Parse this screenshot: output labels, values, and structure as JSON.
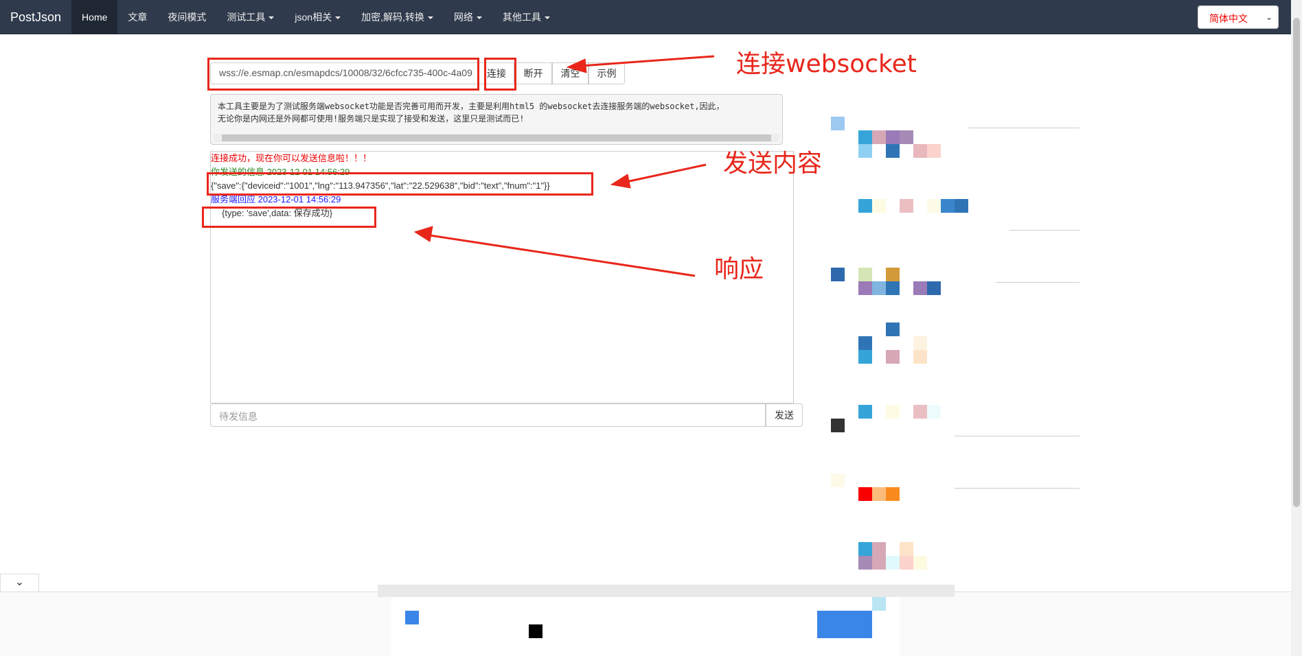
{
  "navbar": {
    "brand": "PostJson",
    "items": [
      {
        "label": "Home"
      },
      {
        "label": "文章"
      },
      {
        "label": "夜间模式"
      },
      {
        "label": "测试工具"
      },
      {
        "label": "json相关"
      },
      {
        "label": "加密,解码,转换"
      },
      {
        "label": "网络"
      },
      {
        "label": "其他工具"
      }
    ],
    "language": "简体中文"
  },
  "tool": {
    "url_value": "wss://e.esmap.cn/esmapdcs/10008/32/6cfcc735-400c-4a09",
    "buttons": {
      "connect": "连接",
      "disconnect": "断开",
      "clear": "清空",
      "example": "示例"
    },
    "description_line1": "本工具主要是为了测试服务端websocket功能是否完善可用而开发，主要是利用html5 的websocket去连接服务端的websocket,因此，",
    "description_line2": "无论你是内网还是外网都可使用!服务端只是实现了接受和发送，这里只是测试而已!",
    "log": {
      "connected": "连接成功，现在你可以发送信息啦！！！",
      "sent_header": "你发送的信息 2023-12-01 14:56:29",
      "sent_body": "{\"save\":{\"deviceid\":\"1001\",\"lng\":\"113.947356\",\"lat\":\"22.529638\",\"bid\":\"text\",\"fnum\":\"1\"}}",
      "reply_header": "服务端回应 2023-12-01 14:56:29",
      "reply_body": "{type: 'save',data: 保存成功}"
    },
    "message_placeholder": "待发信息",
    "send_label": "发送"
  },
  "annotations": {
    "connect": "连接websocket",
    "send": "发送内容",
    "response": "响应"
  },
  "colors": {
    "annotation": "#e8261b",
    "navbar": "#2f3a4c"
  },
  "icons": {
    "collapse": "chevron-down-icon"
  }
}
